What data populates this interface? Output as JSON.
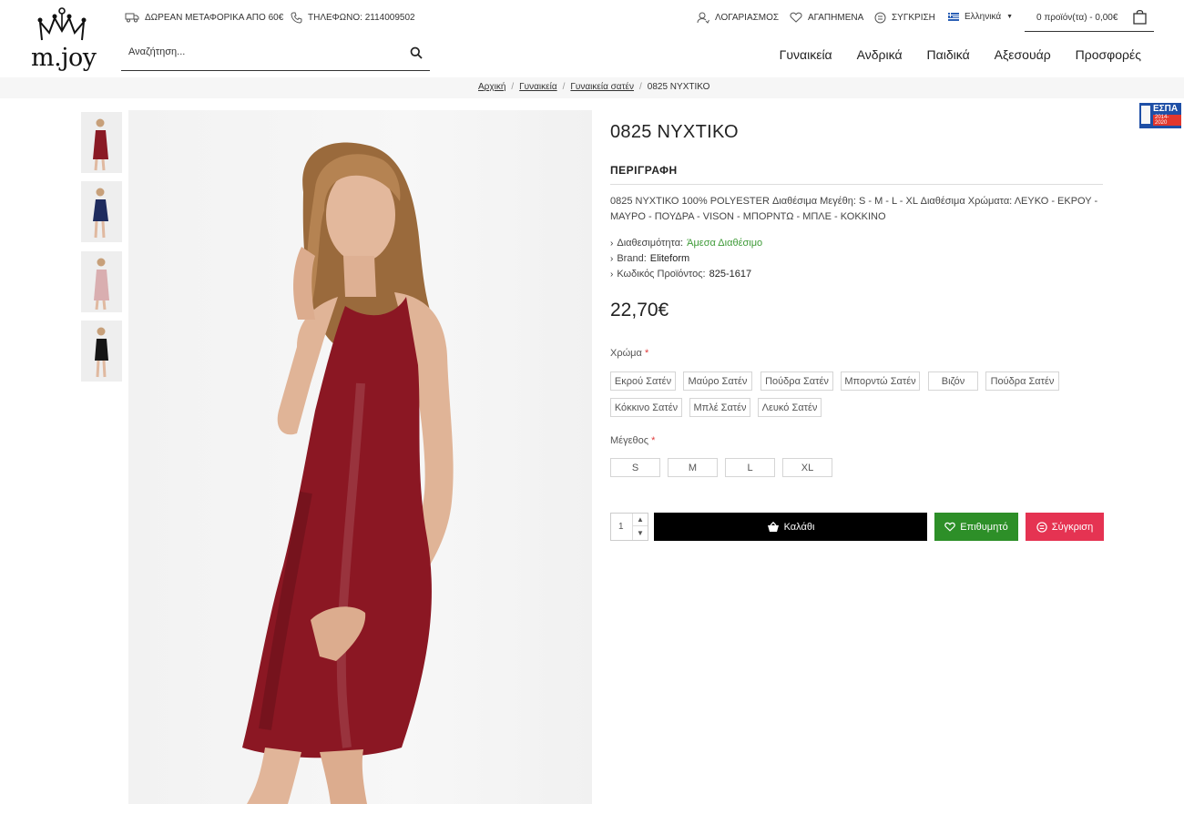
{
  "brand": {
    "logo_text": "m.joy"
  },
  "topbar": {
    "shipping": "ΔΩΡΕΑΝ ΜΕΤΑΦΟΡΙΚΑ ΑΠΟ 60€",
    "phone": "ΤΗΛΕΦΩΝΟ: 2114009502",
    "account": "ΛΟΓΑΡΙΑΣΜΟΣ",
    "wishlist": "ΑΓΑΠΗΜΕΝΑ",
    "compare": "ΣΥΓΚΡΙΣΗ",
    "language": "Ελληνικά",
    "cart": "0 προϊόν(τα) - 0,00€"
  },
  "search": {
    "placeholder": "Αναζήτηση..."
  },
  "nav": {
    "items": [
      {
        "label": "Γυναικεία"
      },
      {
        "label": "Ανδρικά"
      },
      {
        "label": "Παιδικά"
      },
      {
        "label": "Αξεσουάρ"
      },
      {
        "label": "Προσφορές"
      }
    ]
  },
  "breadcrumb": {
    "items": [
      {
        "label": "Αρχική"
      },
      {
        "label": "Γυναικεία"
      },
      {
        "label": "Γυναικεία σατέν"
      },
      {
        "label": "0825 ΝΥΧΤΙΚΟ"
      }
    ]
  },
  "badge": {
    "espa_title": "ΕΣΠΑ",
    "espa_years": "2014-2020"
  },
  "gallery": {
    "thumb_colors": [
      "#8a1a25",
      "#1f2c5e",
      "#d9aeb0",
      "#151515"
    ],
    "main_color": "#8b1723"
  },
  "product": {
    "title": "0825 ΝΥΧΤΙΚΟ",
    "description_heading": "ΠΕΡΙΓΡΑΦΗ",
    "description": "0825 ΝΥΧΤΙΚΟ 100% POLYESTER Διαθέσιμα Μεγέθη: S - M - L - XL Διαθέσιμα Χρώματα: ΛΕΥΚΟ - ΕΚΡΟΥ - ΜΑΥΡΟ - ΠΟΥΔΡΑ - VISON - ΜΠΟΡΝΤΩ - ΜΠΛΕ - ΚΟΚΚΙΝΟ",
    "availability_label": "Διαθεσιμότητα:",
    "availability_value": "Άμεσα Διαθέσιμο",
    "brand_label": "Brand:",
    "brand_value": "Eliteform",
    "code_label": "Κωδικός Προϊόντος:",
    "code_value": "825-1617",
    "price": "22,70€",
    "color_label": "Χρώμα",
    "colors": [
      "Εκρού Σατέν",
      "Μαύρο Σατέν",
      "Πούδρα Σατέν",
      "Μπορντώ Σατέν",
      "Βιζόν",
      "Πούδρα Σατέν",
      "Κόκκινο Σατέν",
      "Μπλέ Σατέν",
      "Λευκό Σατέν"
    ],
    "size_label": "Μέγεθος",
    "sizes": [
      "S",
      "M",
      "L",
      "XL"
    ],
    "required_mark": "*",
    "quantity": "1",
    "add_to_cart": "Καλάθι",
    "wishlist_button": "Επιθυμητό",
    "compare_button": "Σύγκριση"
  },
  "colors": {
    "buy": "#000000",
    "wish": "#2d8f28",
    "compare": "#e53352",
    "available": "#3f9b38",
    "required": "#e03b3b"
  }
}
